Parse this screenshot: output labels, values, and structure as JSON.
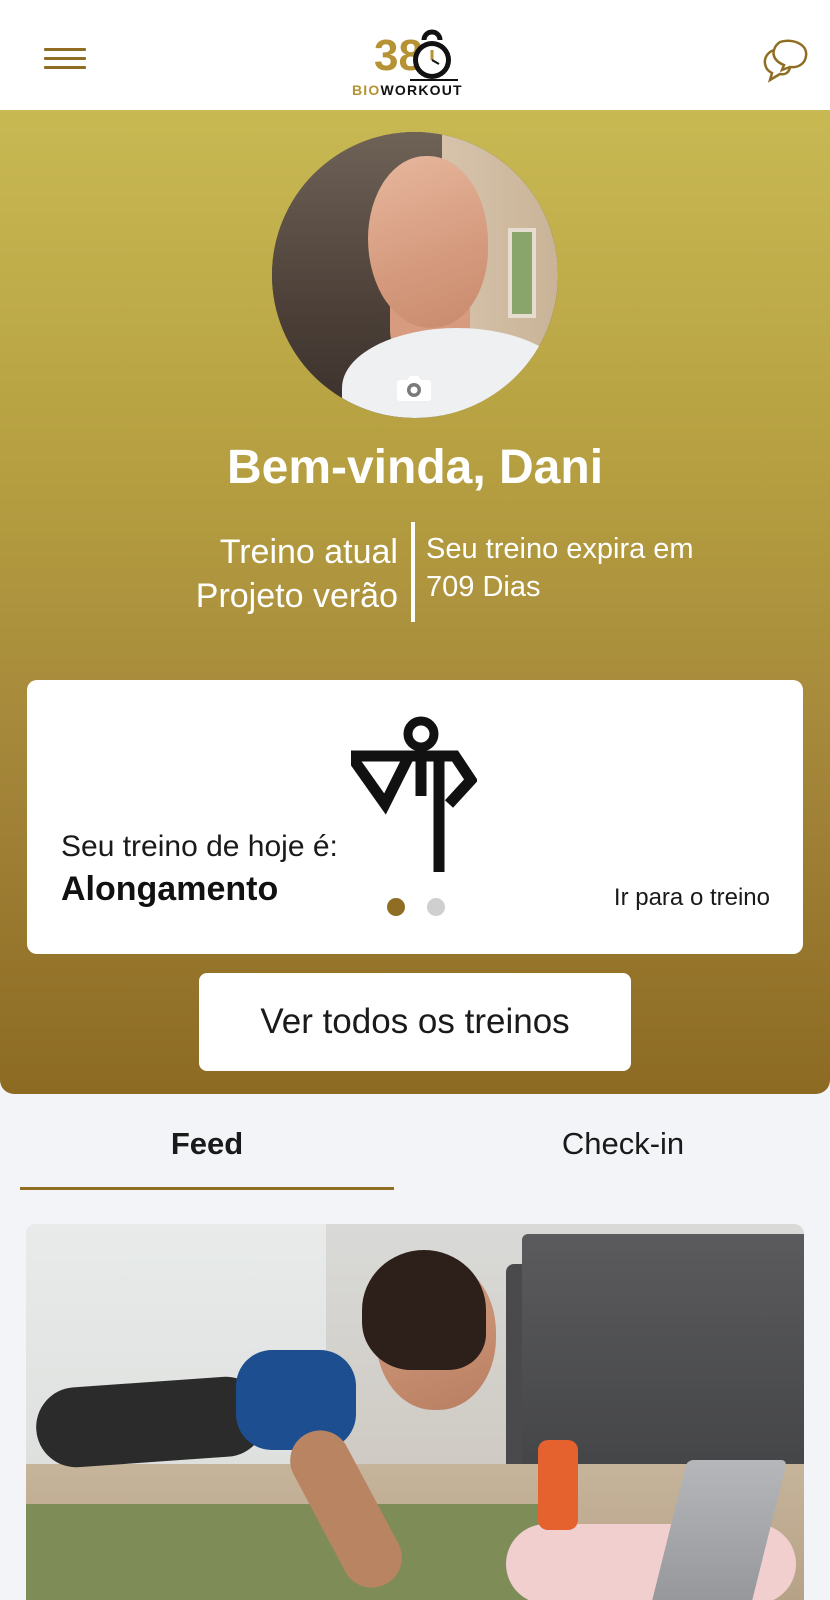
{
  "header": {
    "logo": {
      "number": "38",
      "brand_prefix": "BIO",
      "brand_suffix": "WORKOUT"
    },
    "menu_icon": "hamburger-menu-icon",
    "chat_icon": "chat-bubbles-icon"
  },
  "profile": {
    "camera_icon": "camera-icon",
    "welcome": "Bem-vinda, Dani"
  },
  "plan": {
    "current_label": "Treino atual",
    "current_name": "Projeto verão",
    "expiry_label": "Seu treino expira em",
    "expiry_value": "709 Dias"
  },
  "today": {
    "label": "Seu treino de hoje é:",
    "name": "Alongamento",
    "icon": "stretching-pose-icon",
    "link": "Ir para o treino",
    "carousel": {
      "current": 1,
      "total": 2
    }
  },
  "all_button": "Ver todos os treinos",
  "tabs": [
    {
      "label": "Feed",
      "active": true
    },
    {
      "label": "Check-in",
      "active": false
    }
  ],
  "colors": {
    "accent": "#8f6e24",
    "gold_light": "#c8b953",
    "gold_dark": "#8c6a22",
    "background": "#f3f4f7"
  }
}
